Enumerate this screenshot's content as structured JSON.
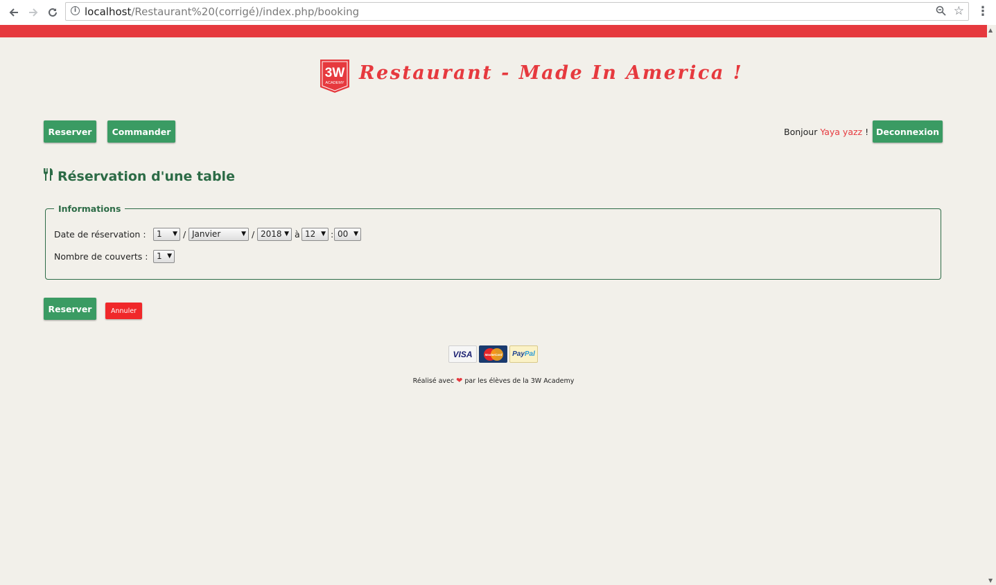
{
  "browser": {
    "url_host": "localhost",
    "url_path": "/Restaurant%20(corrigé)/index.php/booking",
    "back_icon": "arrow-left-icon",
    "forward_icon": "arrow-right-icon",
    "reload_icon": "reload-icon",
    "info_glyph": "i",
    "menu_icon": "vertical-dots-icon"
  },
  "header": {
    "logo_text": "3W",
    "logo_subtext": "ACADEMY",
    "title": "Restaurant - Made In America !"
  },
  "nav": {
    "reserve_label": "Reserver",
    "order_label": "Commander",
    "greeting_prefix": "Bonjour",
    "user_name": "Yaya yazz",
    "greeting_suffix": "!",
    "logout_label": "Deconnexion"
  },
  "page": {
    "title": "Réservation d'une table"
  },
  "form": {
    "legend": "Informations",
    "date_label": "Date de réservation :",
    "day": "1",
    "month": "Janvier",
    "year": "2018",
    "hour": "12",
    "minute": "00",
    "sep_slash": "/",
    "sep_at": "à",
    "sep_colon": ":",
    "covers_label": "Nombre de couverts :",
    "covers": "1",
    "submit_label": "Reserver",
    "cancel_label": "Annuler"
  },
  "footer": {
    "payment_visa": "VISA",
    "payment_mastercard": "MasterCard",
    "payment_paypal_1": "Pay",
    "payment_paypal_2": "Pal",
    "text_before": "Réalisé avec",
    "text_after": "par les élèves de la 3W Academy"
  },
  "colors": {
    "accent_red": "#e6393e",
    "button_green": "#3a9b63",
    "title_green": "#2c6b46",
    "cancel_red": "#f0282a",
    "background": "#f2f0ea"
  }
}
